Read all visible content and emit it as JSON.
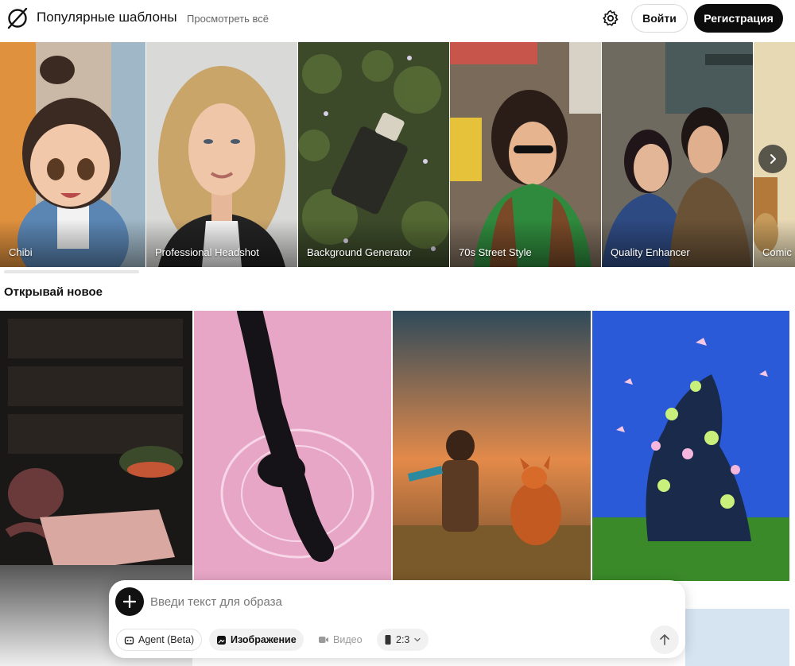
{
  "header": {
    "title": "Популярные шаблоны",
    "view_all": "Просмотреть всё",
    "login_label": "Войти",
    "signup_label": "Регистрация"
  },
  "templates": [
    {
      "label": "Chibi"
    },
    {
      "label": "Professional Headshot"
    },
    {
      "label": "Background Generator"
    },
    {
      "label": "70s Street Style"
    },
    {
      "label": "Quality Enhancer"
    },
    {
      "label": "Comic"
    }
  ],
  "discover": {
    "title": "Открывай новое"
  },
  "prompt": {
    "placeholder": "Введи текст для образа",
    "chips": {
      "agent": "Agent (Beta)",
      "image": "Изображение",
      "video": "Видео",
      "ratio": "2:3"
    }
  },
  "colors": {
    "primary_button": "#0c0c0c",
    "accent_text": "#111111",
    "muted_text": "#666666"
  },
  "icons": [
    "logo-icon",
    "gear-icon",
    "chevron-right-icon",
    "plus-icon",
    "robot-icon",
    "image-icon",
    "video-icon",
    "ratio-icon",
    "chevron-down-icon",
    "arrow-up-icon"
  ]
}
